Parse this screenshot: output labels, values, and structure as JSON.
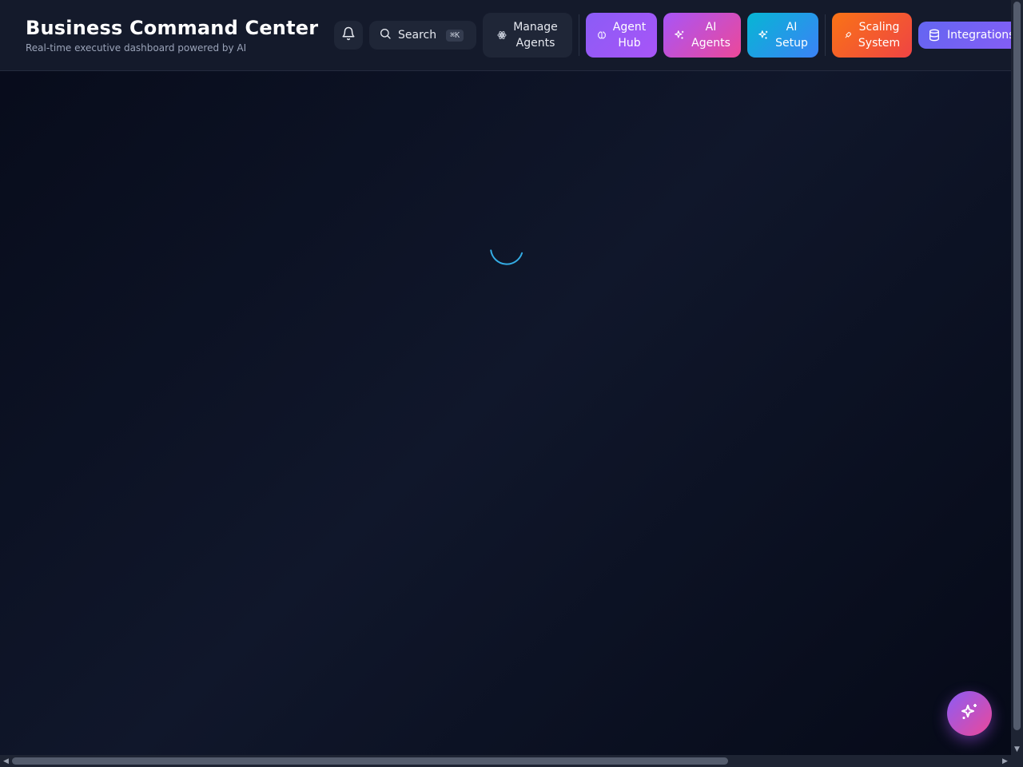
{
  "header": {
    "title": "Business Command Center",
    "subtitle": "Real-time executive dashboard powered by AI"
  },
  "toolbar": {
    "notifications_icon": "bell-icon",
    "search": {
      "label": "Search",
      "shortcut": "⌘K",
      "icon": "search-icon"
    },
    "manage_agents": {
      "label": "Manage\nAgents",
      "icon": "atom-icon"
    },
    "agent_hub": {
      "label": "Agent\nHub",
      "icon": "brain-icon",
      "gradient": [
        "#8b5cf6",
        "#a855f7"
      ]
    },
    "ai_agents": {
      "label": "AI\nAgents",
      "icon": "sparkles-icon",
      "gradient": [
        "#a855f7",
        "#ec4899"
      ]
    },
    "ai_setup": {
      "label": "AI\nSetup",
      "icon": "sparkles-icon",
      "gradient": [
        "#06b6d4",
        "#3b82f6"
      ]
    },
    "scaling_system": {
      "label": "Scaling\nSystem",
      "icon": "rocket-icon",
      "gradient": [
        "#f97316",
        "#ef4444"
      ]
    },
    "integrations": {
      "label": "Integrations",
      "icon": "database-icon",
      "gradient": [
        "#6366f1",
        "#8b5cf6"
      ]
    }
  },
  "main": {
    "state": "loading",
    "spinner_icon": "loading-spinner-icon"
  },
  "fab": {
    "icon": "sparkles-icon",
    "gradient": [
      "#8b5cf6",
      "#ec4899"
    ]
  },
  "colors": {
    "background": "#0b1020",
    "header_bg": "#141a2b",
    "spinner_accent": "#38bdf8"
  }
}
